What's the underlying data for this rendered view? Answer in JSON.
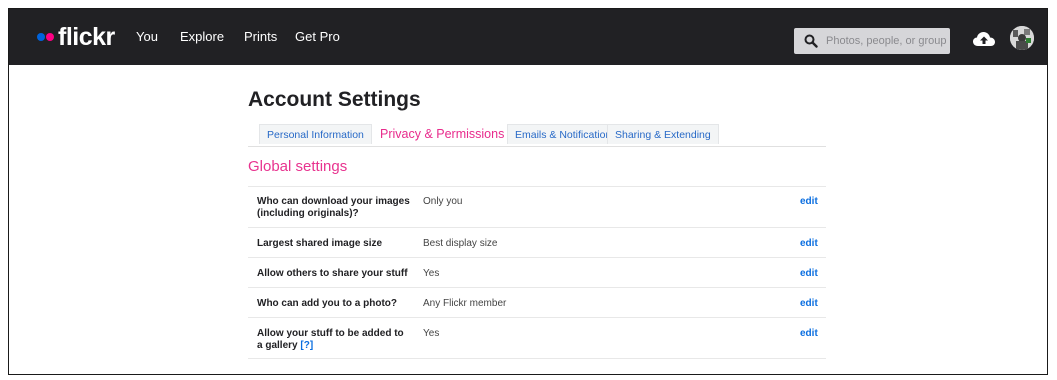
{
  "header": {
    "logo_text": "flickr",
    "logo_dot_colors": [
      "#0063dc",
      "#ff0084"
    ],
    "nav": [
      {
        "label": "You"
      },
      {
        "label": "Explore"
      },
      {
        "label": "Prints"
      },
      {
        "label": "Get Pro"
      }
    ],
    "search": {
      "placeholder": "Photos, people, or groups",
      "icon": "search-icon"
    },
    "upload_icon": "cloud-upload-icon",
    "avatar_icon": "avatar"
  },
  "page": {
    "title": "Account Settings",
    "tabs": [
      {
        "label": "Personal Information",
        "active": false
      },
      {
        "label": "Privacy & Permissions",
        "active": true
      },
      {
        "label": "Emails & Notifications",
        "active": false
      },
      {
        "label": "Sharing & Extending",
        "active": false
      }
    ],
    "section_title": "Global settings",
    "edit_label": "edit",
    "help_label": "?",
    "settings": [
      {
        "label": "Who can download your images (including originals)?",
        "value": "Only you"
      },
      {
        "label": "Largest shared image size",
        "value": "Best display size"
      },
      {
        "label": "Allow others to share your stuff",
        "value": "Yes"
      },
      {
        "label": "Who can add you to a photo?",
        "value": "Any Flickr member"
      },
      {
        "label": "Allow your stuff to be added to a gallery",
        "value": "Yes"
      }
    ]
  },
  "colors": {
    "topbar": "#212124",
    "accent_pink": "#e8338f",
    "link_blue": "#0a6ee0"
  }
}
